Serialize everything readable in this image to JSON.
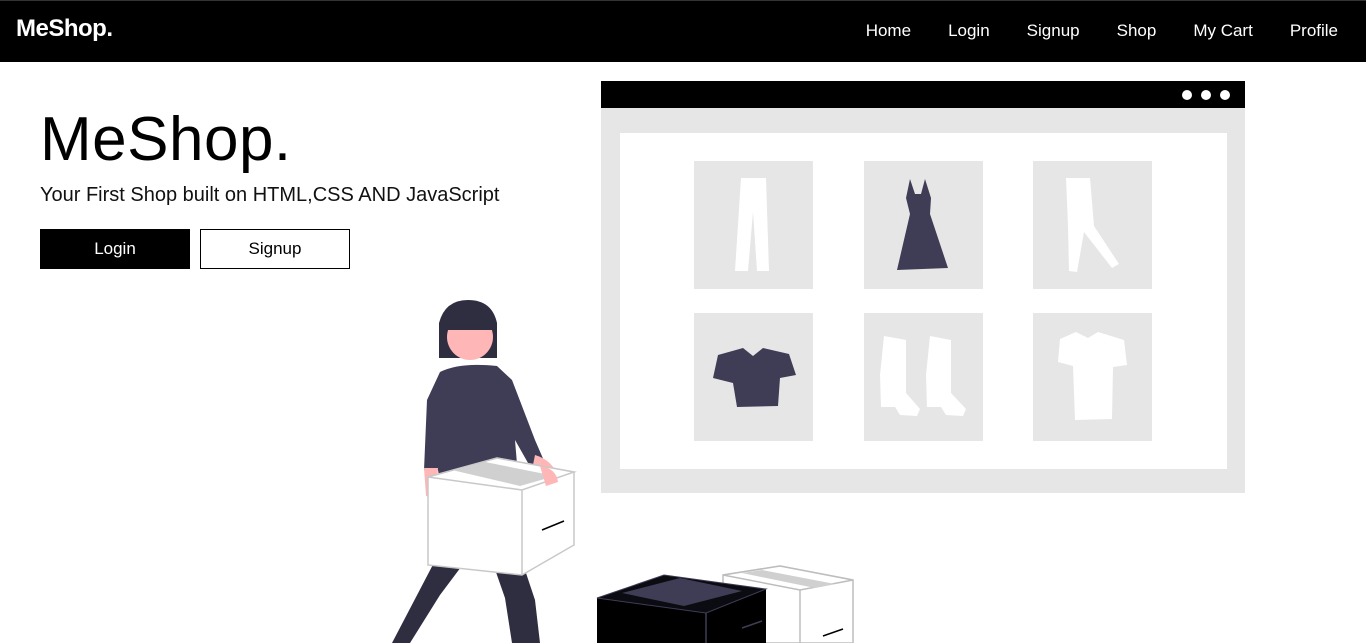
{
  "nav": {
    "brand": "MeShop.",
    "links": [
      "Home",
      "Login",
      "Signup",
      "Shop",
      "My Cart",
      "Profile"
    ]
  },
  "hero": {
    "title": "MeShop.",
    "subtitle": "Your First Shop built on HTML,CSS AND JavaScript",
    "login_label": "Login",
    "signup_label": "Signup"
  },
  "colors": {
    "navbar": "#000000",
    "accent_dark": "#3f3d56",
    "skin": "#ffb6b6",
    "panel": "#e6e6e6"
  }
}
